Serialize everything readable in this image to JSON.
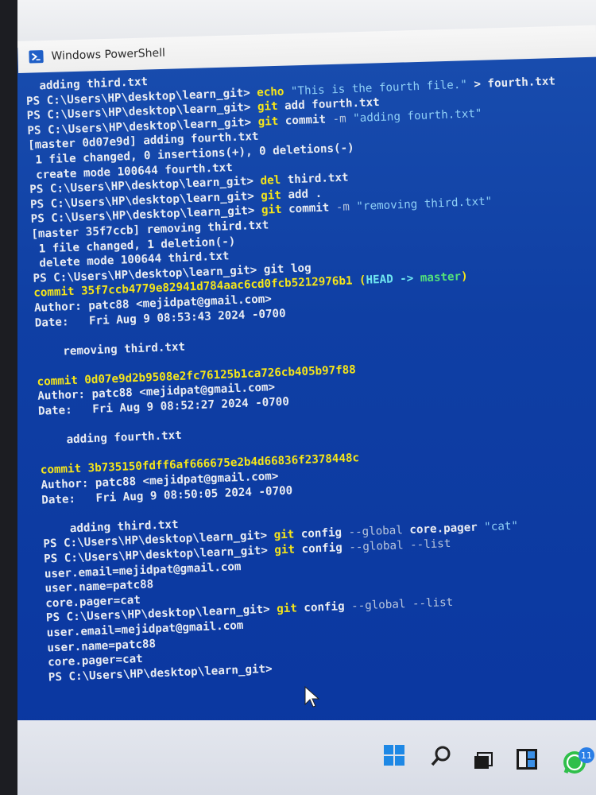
{
  "window": {
    "title": "Windows PowerShell"
  },
  "console": {
    "lines": [
      [
        {
          "t": "  adding third.txt"
        }
      ],
      [
        {
          "t": "PS C:\\Users\\HP\\desktop\\learn_git> "
        },
        {
          "t": "echo ",
          "c": "y"
        },
        {
          "t": "\"This is the fourth file.\"",
          "c": "str"
        },
        {
          "t": " > fourth.txt"
        }
      ],
      [
        {
          "t": "PS C:\\Users\\HP\\desktop\\learn_git> "
        },
        {
          "t": "git",
          "c": "y"
        },
        {
          "t": " add fourth.txt"
        }
      ],
      [
        {
          "t": "PS C:\\Users\\HP\\desktop\\learn_git> "
        },
        {
          "t": "git",
          "c": "y"
        },
        {
          "t": " commit "
        },
        {
          "t": "-m",
          "c": "dim"
        },
        {
          "t": " "
        },
        {
          "t": "\"adding fourth.txt\"",
          "c": "str"
        }
      ],
      [
        {
          "t": "[master 0d07e9d] adding fourth.txt"
        }
      ],
      [
        {
          "t": " 1 file changed, 0 insertions(+), 0 deletions(-)"
        }
      ],
      [
        {
          "t": " create mode 100644 fourth.txt"
        }
      ],
      [
        {
          "t": "PS C:\\Users\\HP\\desktop\\learn_git> "
        },
        {
          "t": "del",
          "c": "y"
        },
        {
          "t": " third.txt"
        }
      ],
      [
        {
          "t": "PS C:\\Users\\HP\\desktop\\learn_git> "
        },
        {
          "t": "git",
          "c": "y"
        },
        {
          "t": " add ."
        }
      ],
      [
        {
          "t": "PS C:\\Users\\HP\\desktop\\learn_git> "
        },
        {
          "t": "git",
          "c": "y"
        },
        {
          "t": " commit "
        },
        {
          "t": "-m",
          "c": "dim"
        },
        {
          "t": " "
        },
        {
          "t": "\"removing third.txt\"",
          "c": "str"
        }
      ],
      [
        {
          "t": "[master 35f7ccb] removing third.txt"
        }
      ],
      [
        {
          "t": " 1 file changed, 1 deletion(-)"
        }
      ],
      [
        {
          "t": " delete mode 100644 third.txt"
        }
      ],
      [
        {
          "t": "PS C:\\Users\\HP\\desktop\\learn_git> git log"
        }
      ],
      [
        {
          "t": "commit 35f7ccb4779e82941d784aac6cd0fcb5212976b1 ",
          "c": "y"
        },
        {
          "t": "(",
          "c": "y"
        },
        {
          "t": "HEAD -> ",
          "c": "cy"
        },
        {
          "t": "master",
          "c": "gr"
        },
        {
          "t": ")",
          "c": "y"
        }
      ],
      [
        {
          "t": "Author: patc88 <mejidpat@gmail.com>"
        }
      ],
      [
        {
          "t": "Date:   Fri Aug 9 08:53:43 2024 -0700"
        }
      ],
      [],
      [
        {
          "t": "    removing third.txt"
        }
      ],
      [],
      [
        {
          "t": "commit 0d07e9d2b9508e2fc76125b1ca726cb405b97f88",
          "c": "y"
        }
      ],
      [
        {
          "t": "Author: patc88 <mejidpat@gmail.com>"
        }
      ],
      [
        {
          "t": "Date:   Fri Aug 9 08:52:27 2024 -0700"
        }
      ],
      [],
      [
        {
          "t": "    adding fourth.txt"
        }
      ],
      [],
      [
        {
          "t": "commit 3b735150fdff6af666675e2b4d66836f2378448c",
          "c": "y"
        }
      ],
      [
        {
          "t": "Author: patc88 <mejidpat@gmail.com>"
        }
      ],
      [
        {
          "t": "Date:   Fri Aug 9 08:50:05 2024 -0700"
        }
      ],
      [],
      [
        {
          "t": "    adding third.txt"
        }
      ],
      [
        {
          "t": "PS C:\\Users\\HP\\desktop\\learn_git> "
        },
        {
          "t": "git",
          "c": "y"
        },
        {
          "t": " config "
        },
        {
          "t": "--global",
          "c": "dim"
        },
        {
          "t": " core.pager "
        },
        {
          "t": "\"cat\"",
          "c": "str"
        }
      ],
      [
        {
          "t": "PS C:\\Users\\HP\\desktop\\learn_git> "
        },
        {
          "t": "git",
          "c": "y"
        },
        {
          "t": " config "
        },
        {
          "t": "--global --list",
          "c": "dim"
        }
      ],
      [
        {
          "t": "user.email=mejidpat@gmail.com"
        }
      ],
      [
        {
          "t": "user.name=patc88"
        }
      ],
      [
        {
          "t": "core.pager=cat"
        }
      ],
      [
        {
          "t": "PS C:\\Users\\HP\\desktop\\learn_git> "
        },
        {
          "t": "git",
          "c": "y"
        },
        {
          "t": " config "
        },
        {
          "t": "--global --list",
          "c": "dim"
        }
      ],
      [
        {
          "t": "user.email=mejidpat@gmail.com"
        }
      ],
      [
        {
          "t": "user.name=patc88"
        }
      ],
      [
        {
          "t": "core.pager=cat"
        }
      ],
      [
        {
          "t": "PS C:\\Users\\HP\\desktop\\learn_git> "
        }
      ]
    ]
  },
  "taskbar": {
    "icons": [
      "windows-start-icon",
      "search-icon",
      "task-view-icon",
      "file-explorer-icon",
      "whatsapp-icon"
    ],
    "whatsapp_badge": "11"
  },
  "colors": {
    "console_bg": "#0f3fa4",
    "command_yellow": "#f5e51a",
    "string_blue": "#8fd0f7",
    "branch_green": "#53e07a",
    "head_cyan": "#6fe6f0"
  }
}
